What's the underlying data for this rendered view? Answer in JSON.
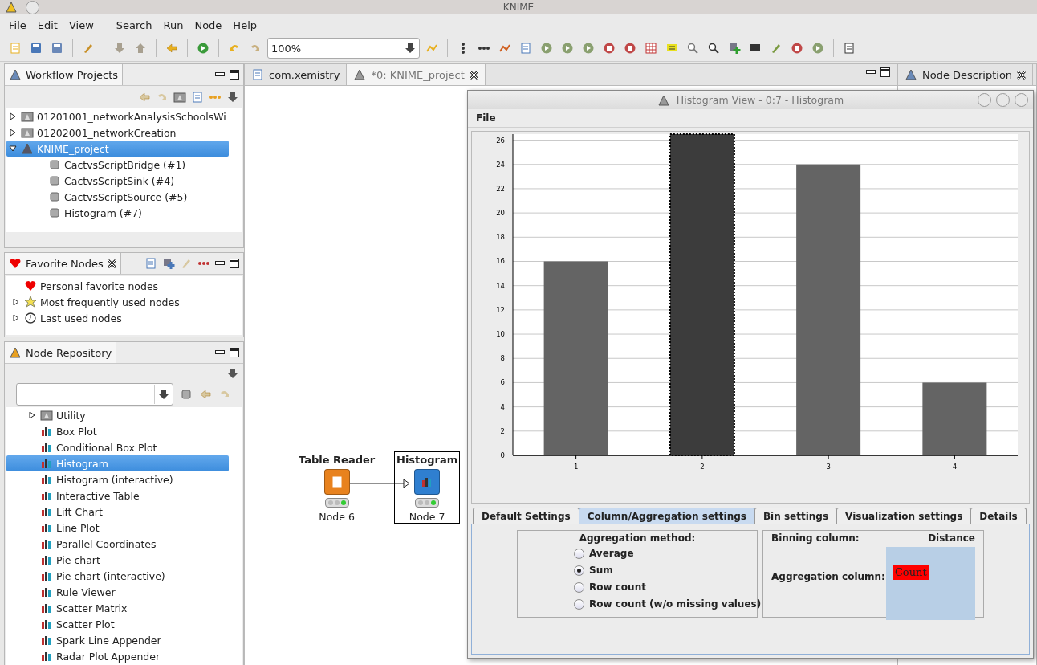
{
  "window": {
    "title": "KNIME"
  },
  "menu": [
    {
      "label": "File"
    },
    {
      "label": "Edit"
    },
    {
      "label": "View"
    },
    {
      "label": "Search"
    },
    {
      "label": "Run"
    },
    {
      "label": "Node"
    },
    {
      "label": "Help"
    }
  ],
  "toolbar": {
    "zoom": "100%"
  },
  "workflow_projects": {
    "title": "Workflow Projects",
    "items": [
      {
        "label": "01201001_networkAnalysisSchoolsWi",
        "expanded": false,
        "selected": false
      },
      {
        "label": "01202001_networkCreation",
        "expanded": false,
        "selected": false
      },
      {
        "label": "KNIME_project",
        "expanded": true,
        "selected": true,
        "children": [
          {
            "label": "CactvsScriptBridge (#1)",
            "selected": false
          },
          {
            "label": "CactvsScriptSink (#4)",
            "selected": false
          },
          {
            "label": "CactvsScriptSource (#5)",
            "selected": false
          },
          {
            "label": "Histogram (#7)",
            "selected": false
          }
        ]
      }
    ]
  },
  "favorite_nodes": {
    "title": "Favorite Nodes",
    "items": [
      {
        "label": "Personal favorite nodes",
        "kind": "heart"
      },
      {
        "label": "Most frequently used nodes",
        "kind": "star"
      },
      {
        "label": "Last used nodes",
        "kind": "clock"
      }
    ]
  },
  "node_repository": {
    "title": "Node Repository",
    "items": [
      {
        "label": "Utility",
        "kind": "category",
        "selected": false
      },
      {
        "label": "Box Plot",
        "kind": "node",
        "selected": false
      },
      {
        "label": "Conditional Box Plot",
        "kind": "node",
        "selected": false
      },
      {
        "label": "Histogram",
        "kind": "node",
        "selected": true
      },
      {
        "label": "Histogram (interactive)",
        "kind": "node",
        "selected": false
      },
      {
        "label": "Interactive Table",
        "kind": "node",
        "selected": false
      },
      {
        "label": "Lift Chart",
        "kind": "node",
        "selected": false
      },
      {
        "label": "Line Plot",
        "kind": "node",
        "selected": false
      },
      {
        "label": "Parallel Coordinates",
        "kind": "node",
        "selected": false
      },
      {
        "label": "Pie chart",
        "kind": "node",
        "selected": false
      },
      {
        "label": "Pie chart (interactive)",
        "kind": "node",
        "selected": false
      },
      {
        "label": "Rule Viewer",
        "kind": "node",
        "selected": false
      },
      {
        "label": "Scatter Matrix",
        "kind": "node",
        "selected": false
      },
      {
        "label": "Scatter Plot",
        "kind": "node",
        "selected": false
      },
      {
        "label": "Spark Line Appender",
        "kind": "node",
        "selected": false
      },
      {
        "label": "Radar Plot Appender",
        "kind": "node",
        "selected": false
      }
    ]
  },
  "editor": {
    "tabs": [
      {
        "label": "com.xemistry",
        "selected": false
      },
      {
        "label": "*0: KNIME_project",
        "selected": true
      }
    ],
    "nodes": [
      {
        "title": "Table Reader",
        "label": "Node 6",
        "color": "#e8821e",
        "selected": false,
        "executed": true
      },
      {
        "title": "Histogram",
        "label": "Node 7",
        "color": "#2f7fd0",
        "selected": true,
        "executed": true
      }
    ]
  },
  "node_description": {
    "title": "Node Description"
  },
  "histogram_view": {
    "title": "Histogram View - 0:7 - Histogram",
    "menu": [
      "File"
    ],
    "chart_data": {
      "type": "bar",
      "categories": [
        "1",
        "2",
        "3",
        "4"
      ],
      "values": [
        16,
        26.5,
        24,
        6
      ],
      "ylim": [
        0,
        26.5
      ],
      "grid": true,
      "yticks": [
        0,
        2,
        4,
        6,
        8,
        10,
        12,
        14,
        16,
        18,
        20,
        22,
        24,
        26
      ]
    },
    "bar_selection": [
      false,
      true,
      false,
      false
    ],
    "tabs": [
      {
        "label": "Default Settings",
        "selected": false
      },
      {
        "label": "Column/Aggregation settings",
        "selected": true
      },
      {
        "label": "Bin settings",
        "selected": false
      },
      {
        "label": "Visualization settings",
        "selected": false
      },
      {
        "label": "Details",
        "selected": false
      }
    ],
    "aggregation": {
      "heading": "Aggregation method:",
      "options": [
        {
          "label": "Average",
          "selected": false
        },
        {
          "label": "Sum",
          "selected": true
        },
        {
          "label": "Row count",
          "selected": false
        },
        {
          "label": "Row count (w/o missing values)",
          "selected": false
        }
      ]
    },
    "columns": {
      "binning_label": "Binning column:",
      "binning_value": "Distance",
      "aggregation_label": "Aggregation column:",
      "aggregation_items": [
        {
          "label": "Count",
          "color": "#ff0000"
        }
      ]
    }
  }
}
